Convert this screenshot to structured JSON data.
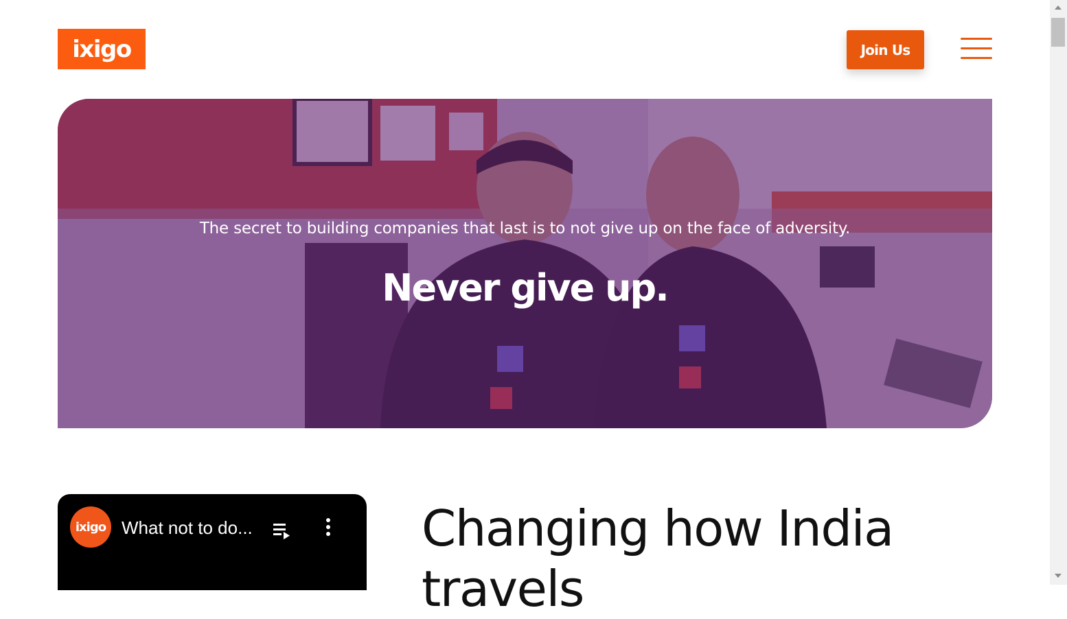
{
  "header": {
    "logo_text": "ixigo",
    "join_label": "Join Us",
    "menu_icon": "hamburger-menu-icon"
  },
  "hero": {
    "subtitle": "The secret to building companies that last is to not give up on the face of adversity.",
    "title": "Never give up."
  },
  "video": {
    "channel_avatar_text": "ixigo",
    "title": "What not to do...",
    "playlist_icon": "playlist-icon",
    "more_icon": "more-vert-icon"
  },
  "section": {
    "heading": "Changing how India travels"
  },
  "colors": {
    "brand_orange": "#fc5c0f",
    "button_orange": "#e8590e",
    "hero_tint": "#5c1e70"
  }
}
